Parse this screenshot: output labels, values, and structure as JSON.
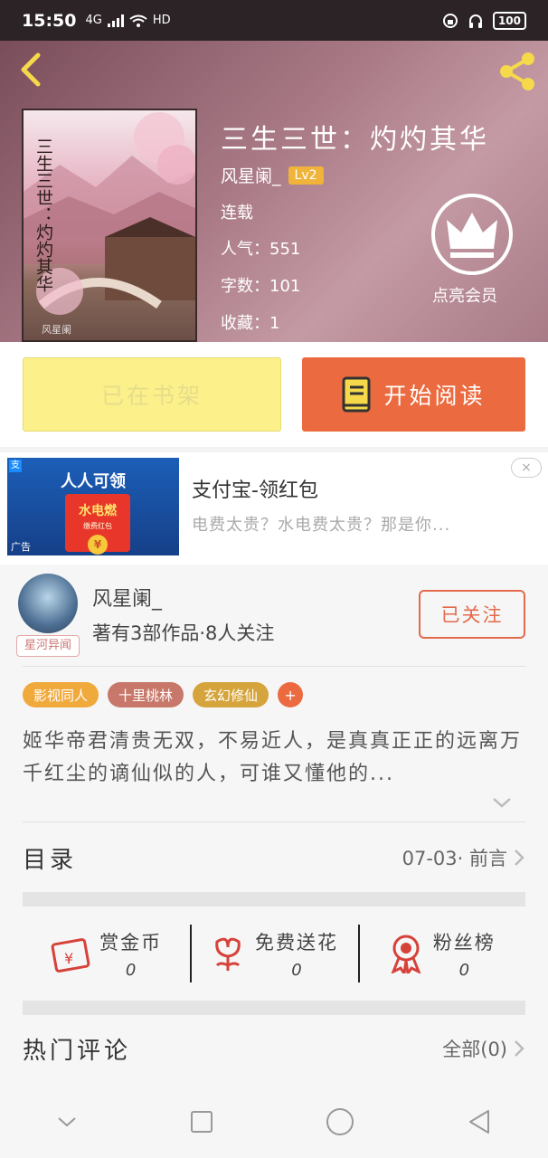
{
  "status_bar": {
    "time": "15:50",
    "network": "4G",
    "wifi_label": "HD",
    "battery": "100"
  },
  "book": {
    "title": "三生三世：灼灼其华",
    "cover_title": "三生三世：灼灼其华",
    "cover_author": "风星阑",
    "author": "风星阑_",
    "level": "Lv2",
    "status": "连载",
    "popularity": "人气：551",
    "word_count": "字数：101",
    "favorites": "收藏：1",
    "vip_label": "点亮会员"
  },
  "actions": {
    "shelf_label": "已在书架",
    "read_label": "开始阅读"
  },
  "ad": {
    "image_headline": "人人可领",
    "envelope_title": "水电燃",
    "envelope_sub": "缴费红包",
    "coin": "¥",
    "ad_tag": "广告",
    "title": "支付宝-领红包",
    "description": "电费太贵？水电费太贵？那是你...",
    "close": "×"
  },
  "author_card": {
    "name": "风星阑_",
    "works": "著有3部作品·8人关注",
    "avatar_tag": "星河异闻",
    "follow_label": "已关注"
  },
  "tags": [
    {
      "label": "影视同人",
      "color": "#f0a93b"
    },
    {
      "label": "十里桃林",
      "color": "#c8786a"
    },
    {
      "label": "玄幻修仙",
      "color": "#d6a43c"
    }
  ],
  "tag_add": "+",
  "intro": "姬华帝君清贵无双，不易近人，是真真正正的远离万千红尘的谪仙似的人，可谁又懂他的...",
  "toc": {
    "label": "目录",
    "latest": "07-03· 前言"
  },
  "stats": [
    {
      "label": "赏金币",
      "value": "0",
      "icon": "red-envelope-icon"
    },
    {
      "label": "免费送花",
      "value": "0",
      "icon": "flower-icon"
    },
    {
      "label": "粉丝榜",
      "value": "0",
      "icon": "medal-icon"
    }
  ],
  "hot_comments": {
    "label": "热门评论",
    "all_label": "全部(0)"
  },
  "colors": {
    "accent": "#ec6a3f",
    "shelf": "#fbf08a",
    "header": "#a97a86"
  }
}
